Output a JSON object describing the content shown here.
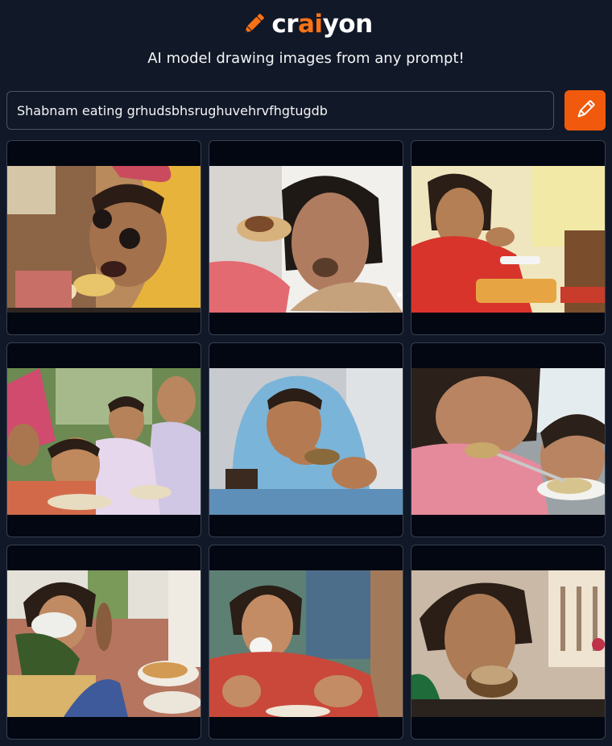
{
  "brand": {
    "name_prefix": "cr",
    "name_accent": "ai",
    "name_suffix": "yon",
    "accent_color": "#f97316",
    "logo_icon": "pencil-icon"
  },
  "header": {
    "tagline": "AI model drawing images from any prompt!"
  },
  "prompt": {
    "value": "Shabnam eating grhudsbhsrughuvehrvfhgtugdb",
    "button_color": "#f15a0c",
    "button_icon": "pencil-icon"
  },
  "results": {
    "count": 9,
    "images": [
      {
        "id": "1"
      },
      {
        "id": "2"
      },
      {
        "id": "3"
      },
      {
        "id": "4"
      },
      {
        "id": "5"
      },
      {
        "id": "6"
      },
      {
        "id": "7"
      },
      {
        "id": "8"
      },
      {
        "id": "9"
      }
    ]
  }
}
